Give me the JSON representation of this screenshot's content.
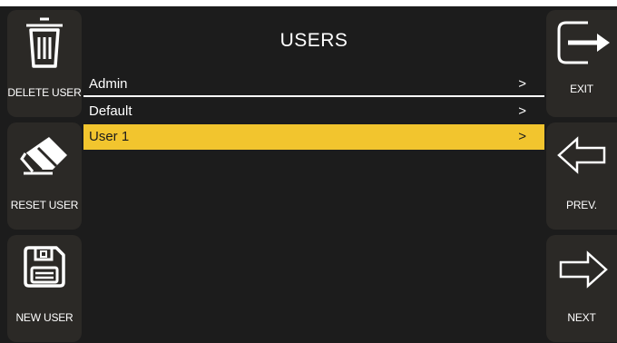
{
  "left_actions": [
    {
      "label": "DELETE USER",
      "icon": "trash-icon"
    },
    {
      "label": "RESET USER",
      "icon": "eraser-icon"
    },
    {
      "label": "NEW USER",
      "icon": "floppy-disk-icon"
    }
  ],
  "right_actions": [
    {
      "label": "EXIT",
      "icon": "exit-icon"
    },
    {
      "label": "PREV.",
      "icon": "arrow-left-icon"
    },
    {
      "label": "NEXT",
      "icon": "arrow-right-icon"
    }
  ],
  "main": {
    "title": "USERS",
    "users": [
      {
        "name": "Admin",
        "arrow": ">",
        "selected": false
      },
      {
        "name": "Default",
        "arrow": ">",
        "selected": false
      },
      {
        "name": "User 1",
        "arrow": ">",
        "selected": true
      }
    ]
  },
  "colors": {
    "background": "#1c1c1c",
    "button": "#2b2926",
    "selected_row": "#f2c52e",
    "text": "#ffffff"
  }
}
